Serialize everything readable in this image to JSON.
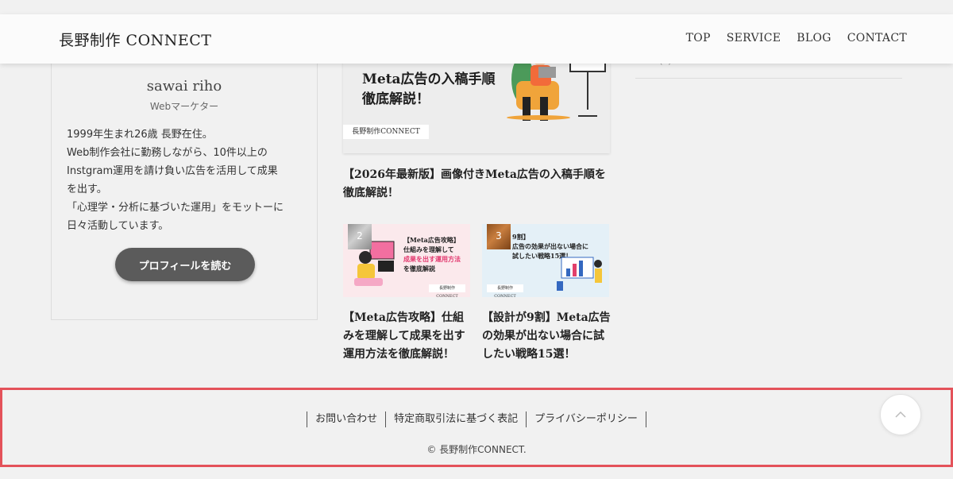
{
  "header": {
    "logo": "長野制作 CONNECT",
    "nav": [
      "TOP",
      "SERVICE",
      "BLOG",
      "CONTACT"
    ]
  },
  "profile": {
    "name": "sawai riho",
    "role": "Webマーケター",
    "bio_lines": [
      "1999年生まれ26歳 長野在住。",
      "Web制作会社に勤務しながら、10件以上の",
      "Instgram運用を請け負い広告を活用して成果",
      "を出す。",
      "「心理学・分析に基づいた運用」をモットーに",
      "日々活動しています。"
    ],
    "button_label": "プロフィールを読む"
  },
  "featured": {
    "thumb_title_line1": "Meta広告の入稿手順",
    "thumb_title_line2": "徹底解説！",
    "thumb_brand": "長野制作CONNECT",
    "title": "【2026年最新版】画像付きMeta広告の入稿手順を徹底解説！"
  },
  "cards": [
    {
      "rank": "2",
      "thumb_lines": [
        "【Meta広告攻略】",
        "仕組みを理解して",
        "成果を出す運用方法",
        "を徹底解説"
      ],
      "thumb_brand": "長野制作CONNECT",
      "title": "【Meta広告攻略】仕組みを理解して成果を出す運用方法を徹底解説！"
    },
    {
      "rank": "3",
      "thumb_lines": [
        "9割】",
        "広告の効果が出ない場合に",
        "試したい戦略15選！"
      ],
      "thumb_brand": "長野制作CONNECT",
      "title": "【設計が9割】Meta広告の効果が出ない場合に試したい戦略15選！"
    }
  ],
  "sidebar": {
    "cut_text": "(3)"
  },
  "footer": {
    "links": [
      "お問い合わせ",
      "特定商取引法に基づく表記",
      "プライバシーポリシー"
    ],
    "copyright": "© 長野制作CONNECT."
  },
  "colors": {
    "highlight_border": "#e4525a",
    "button_bg": "#5b5b5b",
    "page_bg": "#f1f1f1"
  },
  "icons": {
    "to_top": "chevron-up-icon",
    "rank_badge": "ranking-badge-icon"
  }
}
